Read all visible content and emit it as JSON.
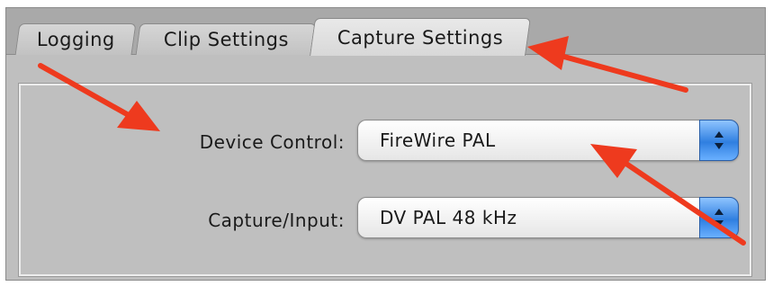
{
  "tabs": [
    {
      "label": "Logging",
      "active": false
    },
    {
      "label": "Clip Settings",
      "active": false
    },
    {
      "label": "Capture Settings",
      "active": true
    }
  ],
  "form": {
    "device_control": {
      "label": "Device Control:",
      "value": "FireWire PAL",
      "icon": "up-down-stepper-icon"
    },
    "capture_input": {
      "label": "Capture/Input:",
      "value": "DV PAL 48 kHz",
      "icon": "up-down-stepper-icon"
    }
  },
  "colors": {
    "annotation_arrow": "#ee3a1e",
    "stepper_blue": "#2f7fe0",
    "window_bg": "#bfbfbf"
  }
}
